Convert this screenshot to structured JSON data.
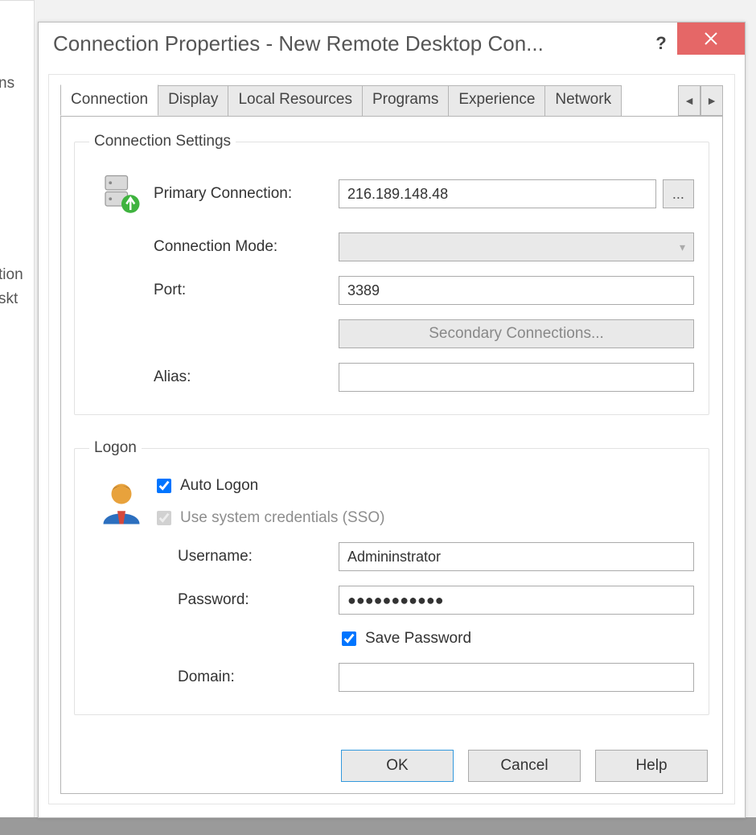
{
  "window": {
    "title": "Connection Properties - New Remote Desktop Con..."
  },
  "background": {
    "text1": "ns",
    "text2": "tion",
    "text3": "skt"
  },
  "tabs": {
    "labels": [
      "Connection",
      "Display",
      "Local Resources",
      "Programs",
      "Experience",
      "Network"
    ],
    "active_index": 0
  },
  "connection_settings": {
    "legend": "Connection Settings",
    "primary_label": "Primary Connection:",
    "primary_value": "216.189.148.48",
    "browse_label": "...",
    "mode_label": "Connection Mode:",
    "mode_value": "",
    "port_label": "Port:",
    "port_value": "3389",
    "secondary_button": "Secondary Connections...",
    "alias_label": "Alias:",
    "alias_value": ""
  },
  "logon": {
    "legend": "Logon",
    "auto_label": "Auto Logon",
    "auto_checked": true,
    "sso_label": "Use system credentials (SSO)",
    "sso_checked": true,
    "sso_disabled": true,
    "username_label": "Username:",
    "username_value": "Admininstrator",
    "password_label": "Password:",
    "password_value": "●●●●●●●●●●●",
    "save_password_label": "Save Password",
    "save_password_checked": true,
    "domain_label": "Domain:",
    "domain_value": ""
  },
  "buttons": {
    "ok": "OK",
    "cancel": "Cancel",
    "help": "Help"
  }
}
